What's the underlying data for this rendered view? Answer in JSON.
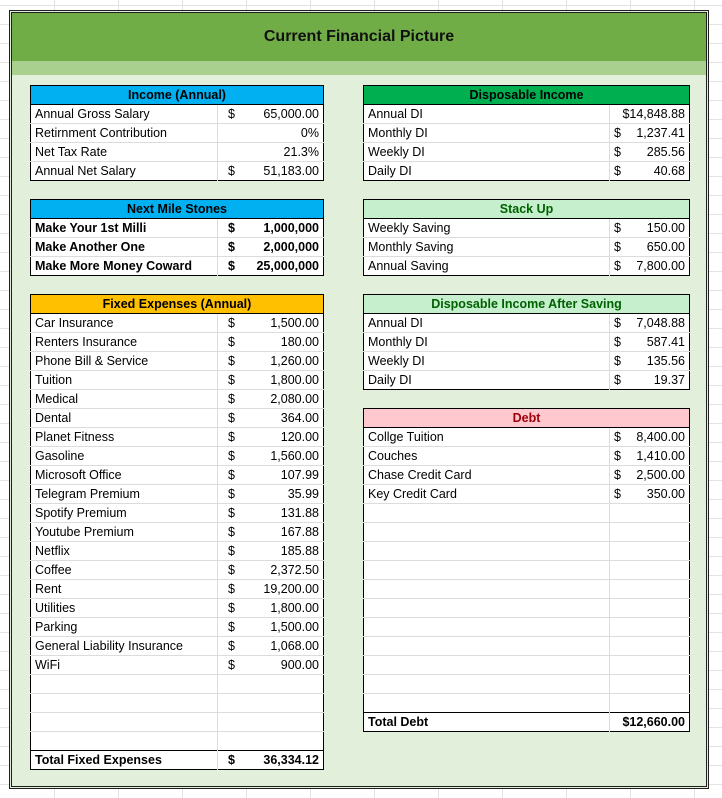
{
  "title": "Current Financial Picture",
  "colors": {
    "title_band": "#70ad47",
    "sub_band": "#a9d08e",
    "body": "#e2efda",
    "income_header": "#00b0f0",
    "milestones_header": "#00b0f0",
    "disposable_header": "#00b050",
    "stackup_header": "#c6efce",
    "stackup_text": "#006100",
    "after_saving_header": "#c6efce",
    "fixed_header": "#ffc000",
    "debt_header": "#ffc7ce",
    "debt_text": "#9c0006"
  },
  "income": {
    "header": "Income (Annual)",
    "rows": [
      {
        "label": "Annual Gross Salary",
        "cur": "$",
        "value": "65,000.00"
      },
      {
        "label": "Retirnment Contribution",
        "cur": "",
        "value": "0%"
      },
      {
        "label": "Net Tax Rate",
        "cur": "",
        "value": "21.3%"
      },
      {
        "label": "Annual Net Salary",
        "cur": "$",
        "value": "51,183.00"
      }
    ]
  },
  "milestones": {
    "header": "Next Mile Stones",
    "rows": [
      {
        "label": "Make Your 1st Milli",
        "cur": "$",
        "value": "1,000,000"
      },
      {
        "label": "Make Another One",
        "cur": "$",
        "value": "2,000,000"
      },
      {
        "label": "Make More Money Coward",
        "cur": "$",
        "value": "25,000,000"
      }
    ]
  },
  "fixed_expenses": {
    "header": "Fixed Expenses (Annual)",
    "rows": [
      {
        "label": "Car Insurance",
        "cur": "$",
        "value": "1,500.00"
      },
      {
        "label": "Renters Insurance",
        "cur": "$",
        "value": "180.00"
      },
      {
        "label": "Phone Bill & Service",
        "cur": "$",
        "value": "1,260.00"
      },
      {
        "label": "Tuition",
        "cur": "$",
        "value": "1,800.00"
      },
      {
        "label": "Medical",
        "cur": "$",
        "value": "2,080.00"
      },
      {
        "label": "Dental",
        "cur": "$",
        "value": "364.00"
      },
      {
        "label": "Planet Fitness",
        "cur": "$",
        "value": "120.00"
      },
      {
        "label": "Gasoline",
        "cur": "$",
        "value": "1,560.00"
      },
      {
        "label": "Microsoft Office",
        "cur": "$",
        "value": "107.99"
      },
      {
        "label": "Telegram Premium",
        "cur": "$",
        "value": "35.99"
      },
      {
        "label": "Spotify Premium",
        "cur": "$",
        "value": "131.88"
      },
      {
        "label": "Youtube Premium",
        "cur": "$",
        "value": "167.88"
      },
      {
        "label": "Netflix",
        "cur": "$",
        "value": "185.88"
      },
      {
        "label": "Coffee",
        "cur": "$",
        "value": "2,372.50"
      },
      {
        "label": "Rent",
        "cur": "$",
        "value": "19,200.00"
      },
      {
        "label": "Utilities",
        "cur": "$",
        "value": "1,800.00"
      },
      {
        "label": "Parking",
        "cur": "$",
        "value": "1,500.00"
      },
      {
        "label": "General Liability Insurance",
        "cur": "$",
        "value": "1,068.00"
      },
      {
        "label": "WiFi",
        "cur": "$",
        "value": "900.00"
      },
      {
        "label": "",
        "cur": "",
        "value": ""
      },
      {
        "label": "",
        "cur": "",
        "value": ""
      },
      {
        "label": "",
        "cur": "",
        "value": ""
      },
      {
        "label": "",
        "cur": "",
        "value": ""
      }
    ],
    "total": {
      "label": "Total Fixed Expenses",
      "cur": "$",
      "value": "36,334.12"
    }
  },
  "disposable_income": {
    "header": "Disposable Income",
    "rows": [
      {
        "label": "Annual DI",
        "cur": "$",
        "value": "14,848.88",
        "tight": true
      },
      {
        "label": "Monthly DI",
        "cur": "$",
        "value": "1,237.41"
      },
      {
        "label": "Weekly DI",
        "cur": "$",
        "value": "285.56"
      },
      {
        "label": "Daily DI",
        "cur": "$",
        "value": "40.68"
      }
    ]
  },
  "stack_up": {
    "header": "Stack Up",
    "rows": [
      {
        "label": "Weekly Saving",
        "cur": "$",
        "value": "150.00"
      },
      {
        "label": "Monthly Saving",
        "cur": "$",
        "value": "650.00"
      },
      {
        "label": "Annual Saving",
        "cur": "$",
        "value": "7,800.00"
      }
    ]
  },
  "after_saving": {
    "header": "Disposable Income After Saving",
    "rows": [
      {
        "label": "Annual DI",
        "cur": "$",
        "value": "7,048.88"
      },
      {
        "label": "Monthly DI",
        "cur": "$",
        "value": "587.41"
      },
      {
        "label": "Weekly DI",
        "cur": "$",
        "value": "135.56"
      },
      {
        "label": "Daily DI",
        "cur": "$",
        "value": "19.37"
      }
    ]
  },
  "debt": {
    "header": "Debt",
    "rows": [
      {
        "label": "Collge Tuition",
        "cur": "$",
        "value": "8,400.00"
      },
      {
        "label": "Couches",
        "cur": "$",
        "value": "1,410.00"
      },
      {
        "label": "Chase Credit Card",
        "cur": "$",
        "value": "2,500.00"
      },
      {
        "label": "Key Credit Card",
        "cur": "$",
        "value": "350.00"
      },
      {
        "label": "",
        "cur": "",
        "value": ""
      },
      {
        "label": "",
        "cur": "",
        "value": ""
      },
      {
        "label": "",
        "cur": "",
        "value": ""
      },
      {
        "label": "",
        "cur": "",
        "value": ""
      },
      {
        "label": "",
        "cur": "",
        "value": ""
      },
      {
        "label": "",
        "cur": "",
        "value": ""
      },
      {
        "label": "",
        "cur": "",
        "value": ""
      },
      {
        "label": "",
        "cur": "",
        "value": ""
      },
      {
        "label": "",
        "cur": "",
        "value": ""
      },
      {
        "label": "",
        "cur": "",
        "value": ""
      },
      {
        "label": "",
        "cur": "",
        "value": ""
      }
    ],
    "total": {
      "label": "Total Debt",
      "cur": "$",
      "value": "12,660.00",
      "tight": true
    }
  }
}
